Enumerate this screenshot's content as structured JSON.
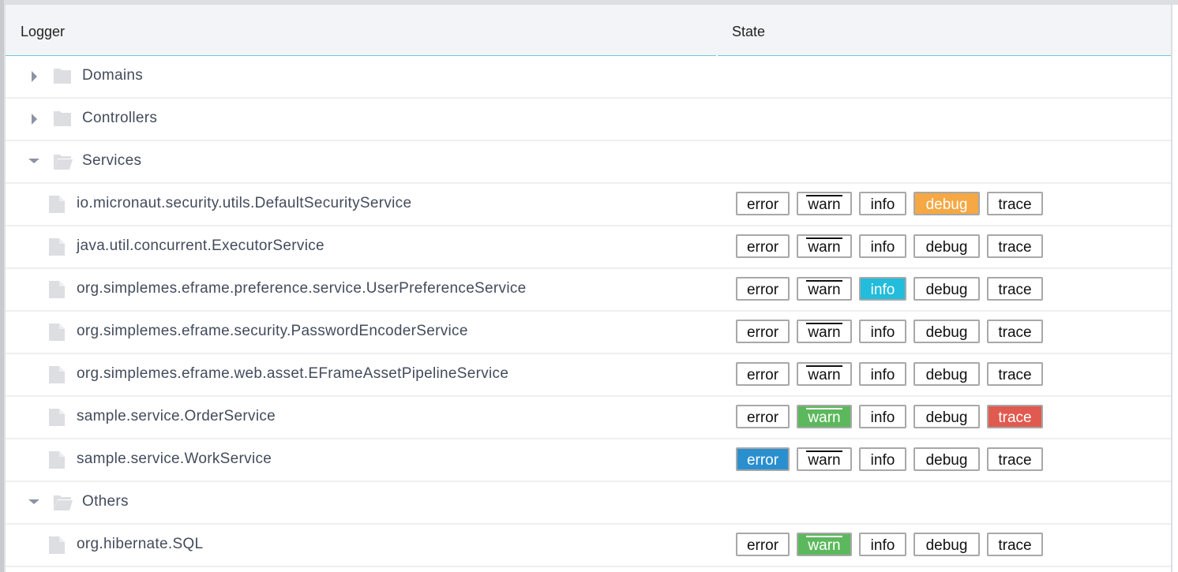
{
  "columns": {
    "logger": "Logger",
    "state": "State"
  },
  "levels": [
    "error",
    "warn",
    "info",
    "debug",
    "trace"
  ],
  "level_colors": {
    "error": "#2a8fcf",
    "warn": "#5cb85c",
    "info": "#22bcdc",
    "debug": "#f5a843",
    "trace": "#e05a4f"
  },
  "rows": [
    {
      "type": "group",
      "label": "Domains",
      "expanded": false
    },
    {
      "type": "group",
      "label": "Controllers",
      "expanded": false
    },
    {
      "type": "group",
      "label": "Services",
      "expanded": true
    },
    {
      "type": "leaf",
      "label": "io.micronaut.security.utils.DefaultSecurityService",
      "active": "debug"
    },
    {
      "type": "leaf",
      "label": "java.util.concurrent.ExecutorService",
      "active": null
    },
    {
      "type": "leaf",
      "label": "org.simplemes.eframe.preference.service.UserPreferenceService",
      "active": "info"
    },
    {
      "type": "leaf",
      "label": "org.simplemes.eframe.security.PasswordEncoderService",
      "active": null
    },
    {
      "type": "leaf",
      "label": "org.simplemes.eframe.web.asset.EFrameAssetPipelineService",
      "active": null
    },
    {
      "type": "leaf",
      "label": "sample.service.OrderService",
      "active": [
        "warn",
        "trace"
      ]
    },
    {
      "type": "leaf",
      "label": "sample.service.WorkService",
      "active": "error"
    },
    {
      "type": "group",
      "label": "Others",
      "expanded": true
    },
    {
      "type": "leaf",
      "label": "org.hibernate.SQL",
      "active": "warn"
    }
  ],
  "icons": {
    "collapsed": "triangle-right-icon",
    "expanded": "triangle-down-icon",
    "folder_closed": "folder-icon",
    "folder_open": "folder-open-icon",
    "file": "file-icon"
  }
}
